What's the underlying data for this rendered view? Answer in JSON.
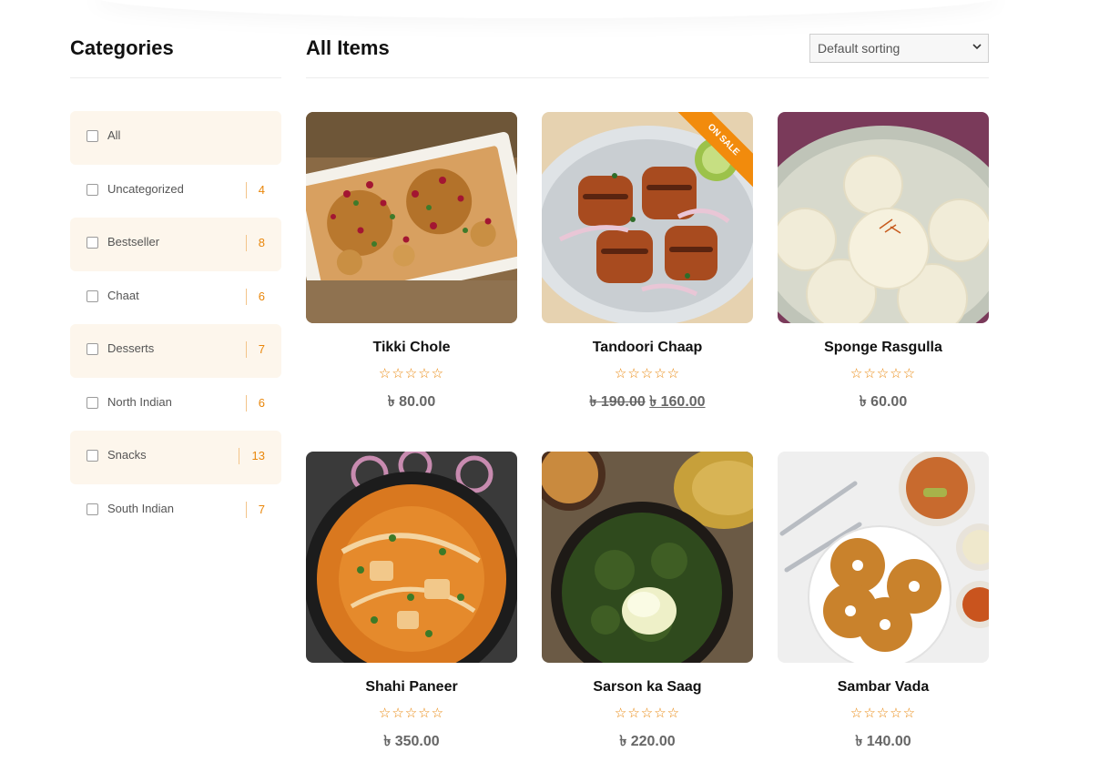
{
  "sidebar": {
    "title": "Categories",
    "categories": [
      {
        "name": "All",
        "count": ""
      },
      {
        "name": "Uncategorized",
        "count": "4"
      },
      {
        "name": "Bestseller",
        "count": "8"
      },
      {
        "name": "Chaat",
        "count": "6"
      },
      {
        "name": "Desserts",
        "count": "7"
      },
      {
        "name": "North Indian",
        "count": "6"
      },
      {
        "name": "Snacks",
        "count": "13"
      },
      {
        "name": "South Indian",
        "count": "7"
      }
    ]
  },
  "main": {
    "title": "All Items",
    "sort": {
      "selected": "Default sorting"
    }
  },
  "products": [
    {
      "name": "Tikki Chole",
      "rating_stars": 0,
      "price": "৳ 80.00",
      "old_price": "",
      "sale_badge": ""
    },
    {
      "name": "Tandoori Chaap",
      "rating_stars": 0,
      "price": "৳ 160.00",
      "old_price": "৳ 190.00",
      "sale_badge": "ON SALE"
    },
    {
      "name": "Sponge Rasgulla",
      "rating_stars": 0,
      "price": "৳ 60.00",
      "old_price": "",
      "sale_badge": ""
    },
    {
      "name": "Shahi Paneer",
      "rating_stars": 0,
      "price": "৳ 350.00",
      "old_price": "",
      "sale_badge": ""
    },
    {
      "name": "Sarson ka Saag",
      "rating_stars": 0,
      "price": "৳ 220.00",
      "old_price": "",
      "sale_badge": ""
    },
    {
      "name": "Sambar Vada",
      "rating_stars": 0,
      "price": "৳ 140.00",
      "old_price": "",
      "sale_badge": ""
    }
  ],
  "colors": {
    "accent": "#e9860a",
    "sale_badge": "#f28b0c",
    "category_shade": "#fdf6ec"
  },
  "icons": {
    "star": "star-outline-icon",
    "checkbox": "checkbox-icon",
    "dropdown": "chevron-down-icon"
  }
}
